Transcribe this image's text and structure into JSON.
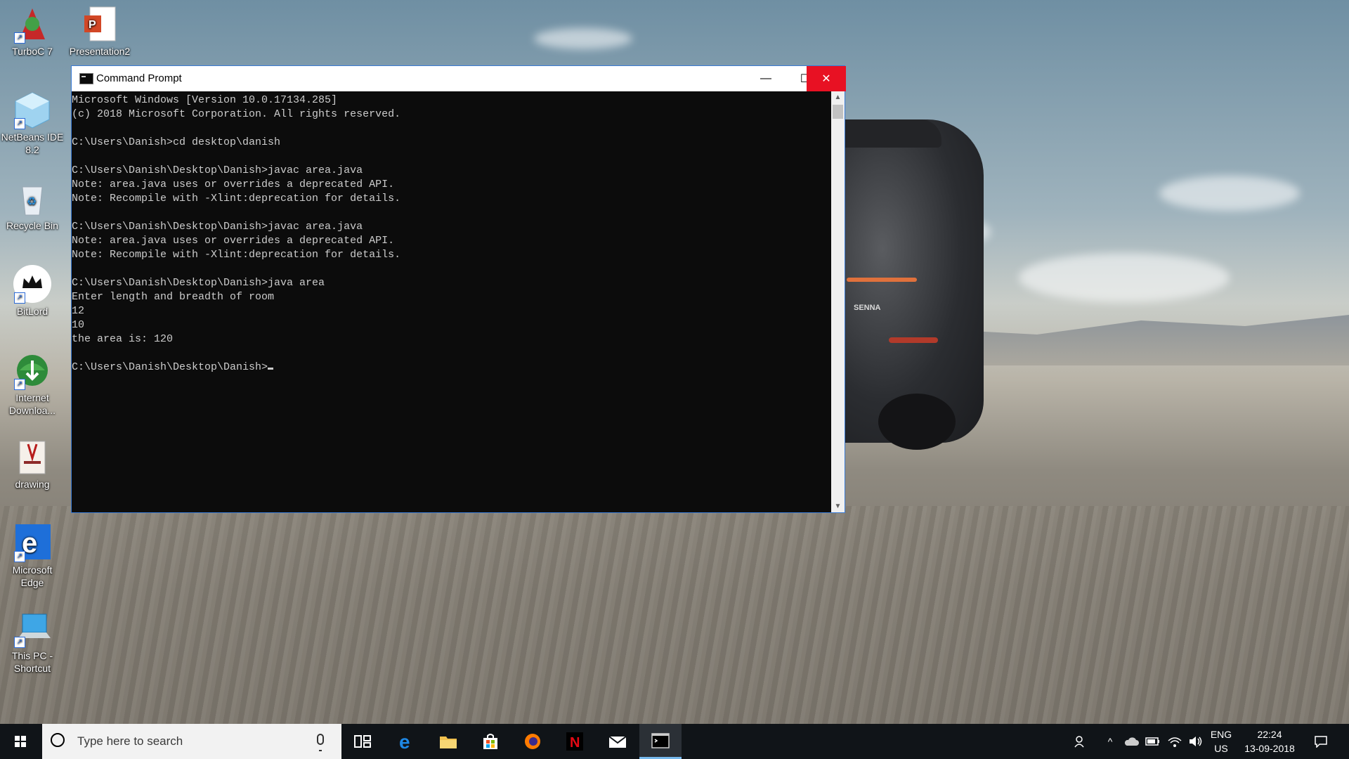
{
  "desktop": {
    "icons": [
      {
        "label": "TurboC 7"
      },
      {
        "label": "Presentation2"
      },
      {
        "label": "NetBeans IDE 8.2"
      },
      {
        "label": "Recycle Bin"
      },
      {
        "label": "BitLord"
      },
      {
        "label": "Internet Downloa..."
      },
      {
        "label": "drawing"
      },
      {
        "label": "Microsoft Edge"
      },
      {
        "label": "This PC - Shortcut"
      }
    ],
    "wallpaper_badge": "SENNA"
  },
  "window": {
    "title": "Command Prompt",
    "minimize_glyph": "—",
    "maximize_glyph": "☐",
    "close_glyph": "✕",
    "console_lines": [
      "Microsoft Windows [Version 10.0.17134.285]",
      "(c) 2018 Microsoft Corporation. All rights reserved.",
      "",
      "C:\\Users\\Danish>cd desktop\\danish",
      "",
      "C:\\Users\\Danish\\Desktop\\Danish>javac area.java",
      "Note: area.java uses or overrides a deprecated API.",
      "Note: Recompile with -Xlint:deprecation for details.",
      "",
      "C:\\Users\\Danish\\Desktop\\Danish>javac area.java",
      "Note: area.java uses or overrides a deprecated API.",
      "Note: Recompile with -Xlint:deprecation for details.",
      "",
      "C:\\Users\\Danish\\Desktop\\Danish>java area",
      "Enter length and breadth of room",
      "12",
      "10",
      "the area is: 120",
      ""
    ],
    "prompt": "C:\\Users\\Danish\\Desktop\\Danish>"
  },
  "taskbar": {
    "search_placeholder": "Type here to search",
    "language": "ENG",
    "region": "US",
    "time": "22:24",
    "date": "13-09-2018"
  },
  "colors": {
    "console_bg": "#0c0c0c",
    "console_text": "#cccccc",
    "close_red": "#e81123",
    "taskbar_bg": "#101418"
  }
}
